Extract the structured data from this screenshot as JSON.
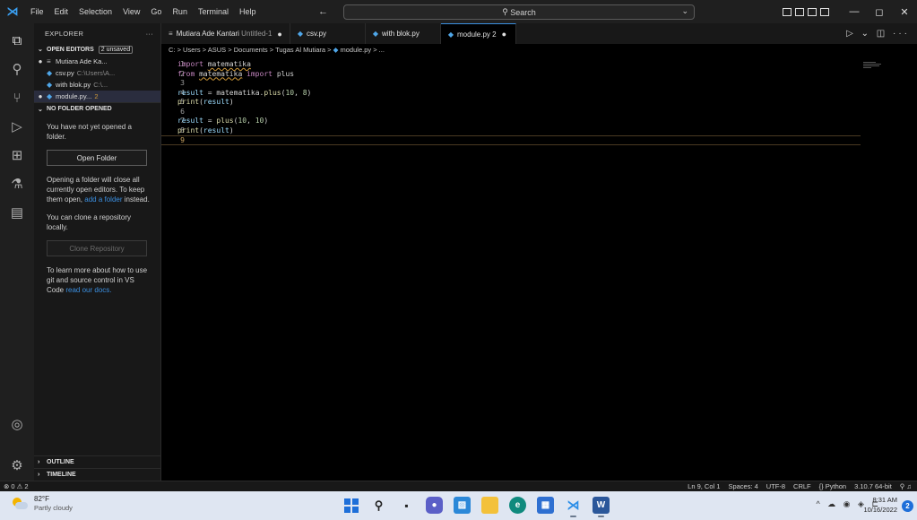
{
  "titlebar": {
    "menu": [
      "File",
      "Edit",
      "Selection",
      "View",
      "Go",
      "Run",
      "Terminal",
      "Help"
    ],
    "search_placeholder": "Search",
    "nav_arrows": "← →"
  },
  "sidebar": {
    "title": "EXPLORER",
    "more": "···",
    "open_editors_label": "OPEN EDITORS",
    "unsaved_badge": "2 unsaved",
    "open_editors": [
      {
        "dot": "●",
        "icon": "≡",
        "name": "Mutiara Ade Ka...",
        "path": ""
      },
      {
        "dot": "",
        "icon": "◆",
        "name": "csv.py",
        "path": "C:\\Users\\A..."
      },
      {
        "dot": "",
        "icon": "◆",
        "name": "with blok.py",
        "path": "C:\\..."
      },
      {
        "dot": "●",
        "icon": "◆",
        "name": "module.py...",
        "path": "2"
      }
    ],
    "no_folder_label": "NO FOLDER OPENED",
    "no_folder_text": "You have not yet opened a folder.",
    "open_folder_button": "Open Folder",
    "opening_text": "Opening a folder will close all currently open editors. To keep them open,",
    "add_folder_link": "add a folder",
    "instead_text": "instead.",
    "clone_text": "You can clone a repository locally.",
    "clone_button": "Clone Repository",
    "learn_text": "To learn more about how to use git and source control in VS Code",
    "read_docs_link": "read our docs.",
    "outline_label": "OUTLINE",
    "timeline_label": "TIMELINE"
  },
  "tabs": [
    {
      "icon": "≡",
      "label": "Mutiara Ade Kantari",
      "sub": "Untitled-1",
      "modified": "●"
    },
    {
      "icon": "◆",
      "label": "csv.py",
      "sub": "",
      "modified": ""
    },
    {
      "icon": "◆",
      "label": "with blok.py",
      "sub": "",
      "modified": ""
    },
    {
      "icon": "◆",
      "label": "module.py 2",
      "sub": "",
      "modified": "●"
    }
  ],
  "tab_actions": "▷ ⌄ ◫ ···",
  "breadcrumb": {
    "path": "C: > Users > ASUS > Documents > Tugas Al Mutiara >",
    "file": "module.py > ..."
  },
  "editor": {
    "line_numbers": [
      "1",
      "2",
      "3",
      "4",
      "5",
      "6",
      "7",
      "8",
      "9"
    ],
    "code_lines": [
      "import matematika",
      "from matematika import plus",
      "",
      "result = matematika.plus(10, 8)",
      "print(result)",
      "",
      "result = plus(10, 10)",
      "print(result)",
      ""
    ],
    "current_line": 9
  },
  "statusbar": {
    "problems": "⊗ 0 ⚠ 2",
    "position": "Ln 9, Col 1",
    "spaces": "Spaces: 4",
    "encoding": "UTF-8",
    "eol": "CRLF",
    "language": "{} Python",
    "interpreter": "3.10.7 64-bit",
    "feedback": "⚲ ♫"
  },
  "taskbar": {
    "weather_temp": "82°F",
    "weather_cond": "Partly cloudy",
    "tray": "^ ☁ ◉ ◈ ⊏",
    "time": "8:31 AM",
    "date": "10/16/2022",
    "notification_count": "2"
  },
  "colors": {
    "accent": "#3b8fe0",
    "editor_bg": "#000000",
    "warning_underline": "#d19a3a"
  }
}
